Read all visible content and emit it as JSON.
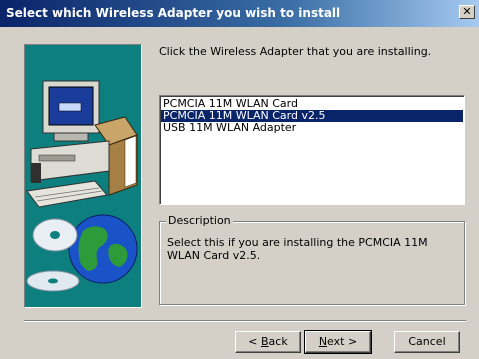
{
  "window": {
    "title": "Select which Wireless Adapter you wish to install",
    "close_glyph": "✕"
  },
  "instruction": "Click the Wireless Adapter that you are installing.",
  "adapters": {
    "items": [
      "PCMCIA 11M WLAN Card",
      "PCMCIA 11M WLAN Card v2.5",
      "USB 11M WLAN Adapter"
    ],
    "selected_index": 1
  },
  "description": {
    "legend": "Description",
    "text": "Select this if you are installing the PCMCIA 11M WLAN Card v2.5."
  },
  "buttons": {
    "back": {
      "prefix": "< ",
      "mnemonic": "B",
      "rest": "ack"
    },
    "next": {
      "mnemonic": "N",
      "rest": "ext >"
    },
    "cancel": "Cancel"
  },
  "colors": {
    "title_bar": "#0a246a",
    "art_background": "#0d7f7f",
    "selection": "#0a246a"
  },
  "icons": {
    "art": "computer-with-box-and-globe-cd-illustration"
  }
}
